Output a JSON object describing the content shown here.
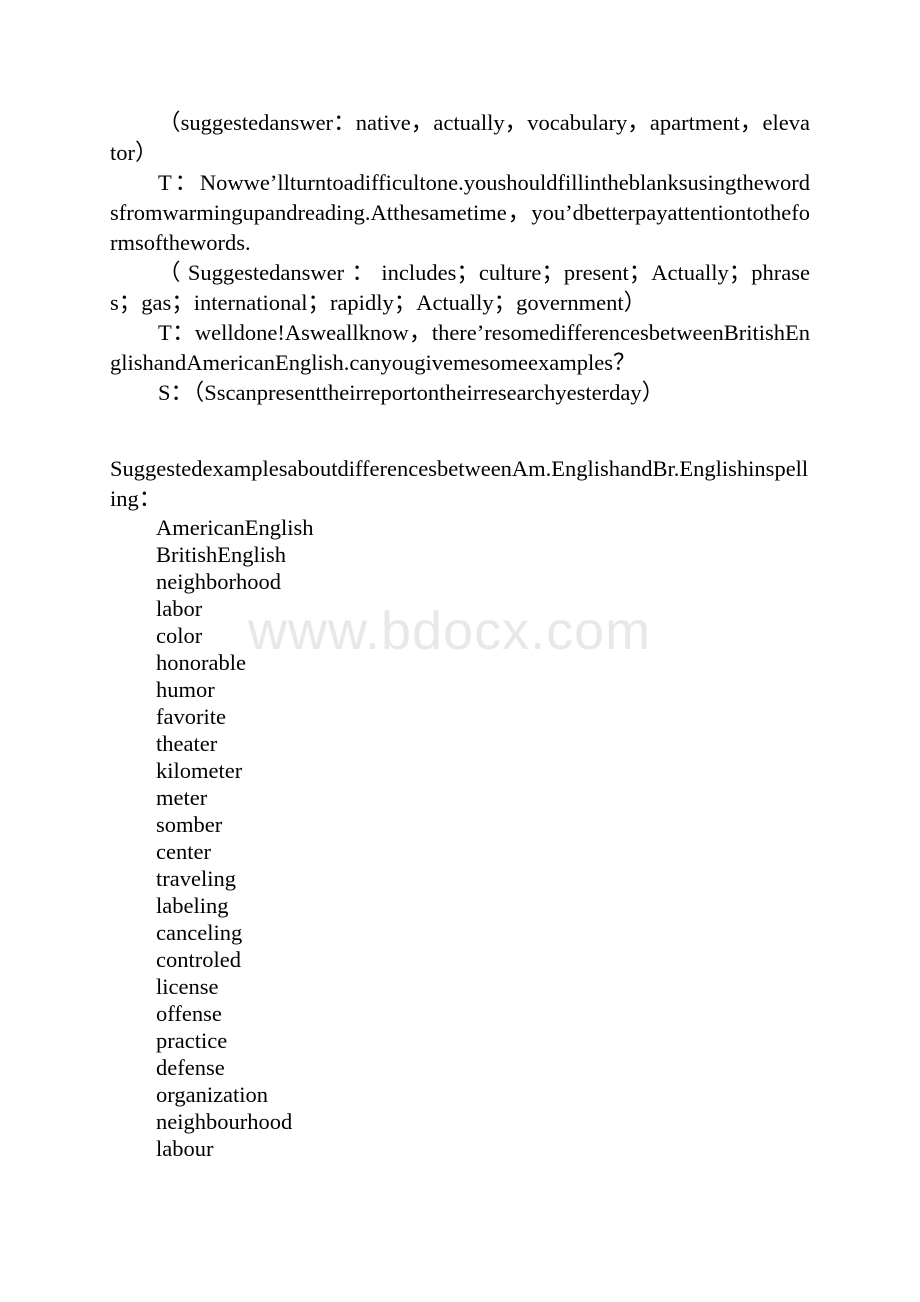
{
  "document": {
    "watermark": "www.bdocx.com",
    "paragraphs": [
      {
        "id": "suggested-answer-1",
        "indent": true,
        "text": "（suggestedanswer：native，actually，vocabulary，apartment，elevator）"
      },
      {
        "id": "teacher-turn-1",
        "indent": true,
        "text": "T：Nowwe’llturntoadifficultone.youshouldfillintheblanksusingthewordsfromwarmingupandreading.Atthesametime，you’dbetterpayattentiontotheformsofthewords."
      },
      {
        "id": "suggested-answer-2",
        "indent": true,
        "text": "（Suggestedanswer：includes；culture；present；Actually；phrases；gas；international；rapidly；Actually；government）"
      },
      {
        "id": "teacher-turn-2",
        "indent": true,
        "text": "T：welldone!Asweallknow，there’resomedifferencesbetweenBritishEnglishandAmericanEnglish.canyougivemesomeexamples？"
      },
      {
        "id": "student-turn-1",
        "indent": true,
        "text": "S：（Sscanpresenttheirreportontheirresearchyesterday）"
      },
      {
        "id": "suggested-examples-heading",
        "indent": false,
        "text": "SuggestedexamplesaboutdifferencesbetweenAm.EnglishandBr.Englishinspelling："
      }
    ],
    "word_list": {
      "id": "spelling-differences-list",
      "items": [
        "AmericanEnglish",
        "BritishEnglish",
        "neighborhood",
        "labor",
        "color",
        "honorable",
        "humor",
        "favorite",
        "theater",
        "kilometer",
        "meter",
        "somber",
        "center",
        "traveling",
        "labeling",
        "canceling",
        "controled",
        "license",
        "offense",
        "practice",
        "defense",
        "organization",
        "neighbourhood",
        "labour"
      ]
    }
  },
  "colors": {
    "text": "#000000",
    "background": "#ffffff",
    "watermark": "#e8e8e8"
  }
}
